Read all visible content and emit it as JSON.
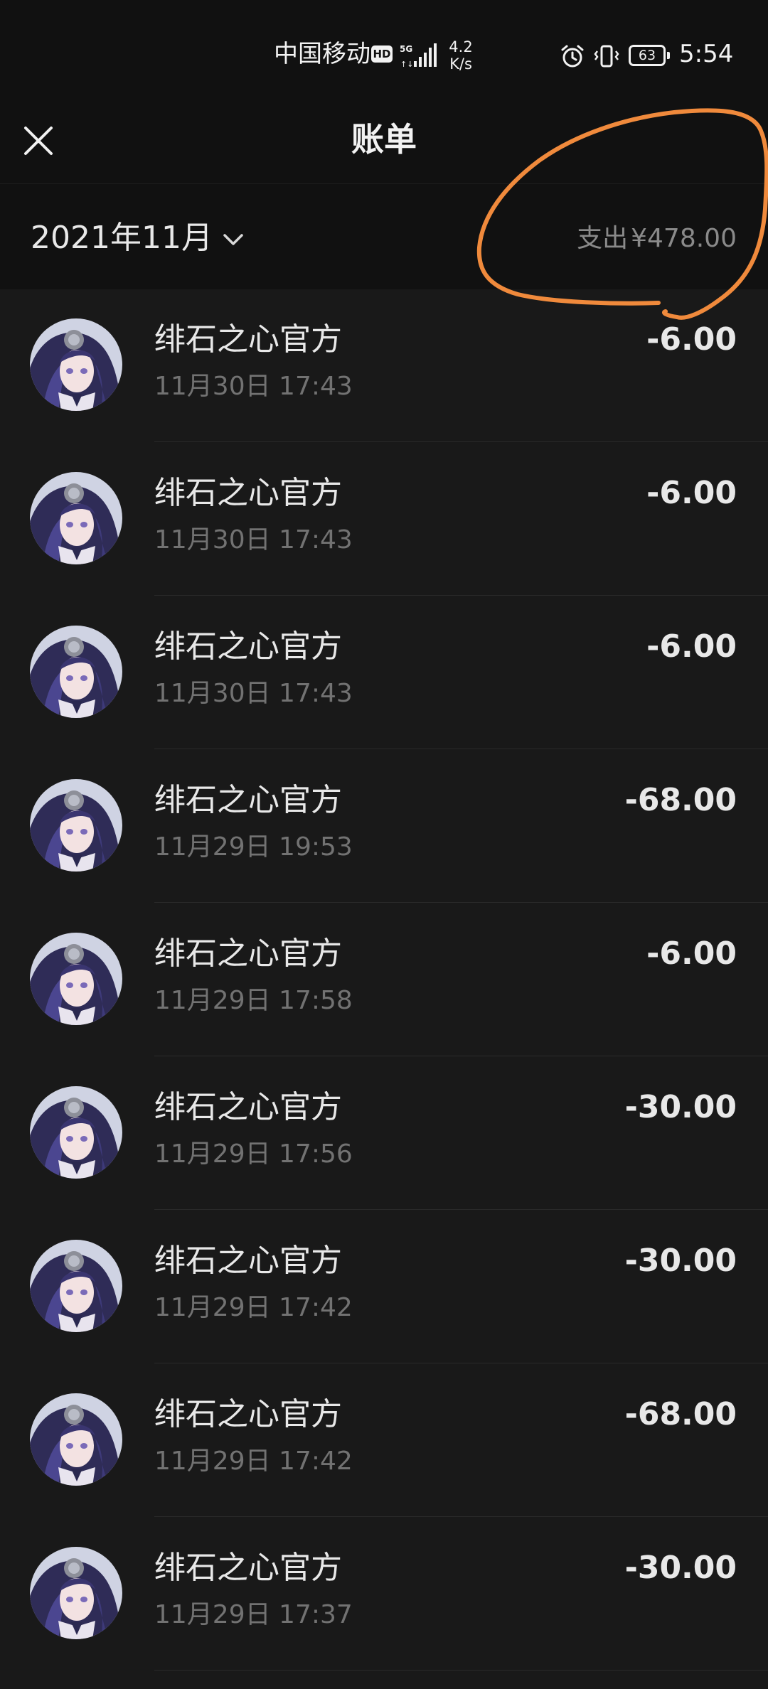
{
  "status_bar": {
    "carrier": "中国移动",
    "hd_badge": "HD",
    "network_speed": "4.2\nK/s",
    "battery_level": "63",
    "time": "5:54",
    "icons": [
      "hd-icon",
      "signal-5g-icon",
      "alarm-icon",
      "vibrate-icon",
      "battery-icon"
    ]
  },
  "header": {
    "title": "账单",
    "close_icon": "close-icon"
  },
  "summary": {
    "month_label": "2021年11月",
    "chevron_icon": "chevron-down-icon",
    "expense_label": "支出",
    "expense_amount": "¥478.00"
  },
  "annotation": {
    "color": "#f08a3c"
  },
  "transactions": [
    {
      "merchant": "绯石之心官方",
      "datetime": "11月30日 17:43",
      "amount": "-6.00"
    },
    {
      "merchant": "绯石之心官方",
      "datetime": "11月30日 17:43",
      "amount": "-6.00"
    },
    {
      "merchant": "绯石之心官方",
      "datetime": "11月30日 17:43",
      "amount": "-6.00"
    },
    {
      "merchant": "绯石之心官方",
      "datetime": "11月29日 19:53",
      "amount": "-68.00"
    },
    {
      "merchant": "绯石之心官方",
      "datetime": "11月29日 17:58",
      "amount": "-6.00"
    },
    {
      "merchant": "绯石之心官方",
      "datetime": "11月29日 17:56",
      "amount": "-30.00"
    },
    {
      "merchant": "绯石之心官方",
      "datetime": "11月29日 17:42",
      "amount": "-30.00"
    },
    {
      "merchant": "绯石之心官方",
      "datetime": "11月29日 17:42",
      "amount": "-68.00"
    },
    {
      "merchant": "绯石之心官方",
      "datetime": "11月29日 17:37",
      "amount": "-30.00"
    }
  ],
  "colors": {
    "background": "#191919",
    "header_background": "#111111",
    "primary_text": "#e8e8e8",
    "secondary_text": "#727272",
    "summary_text": "#8a8a8a"
  }
}
